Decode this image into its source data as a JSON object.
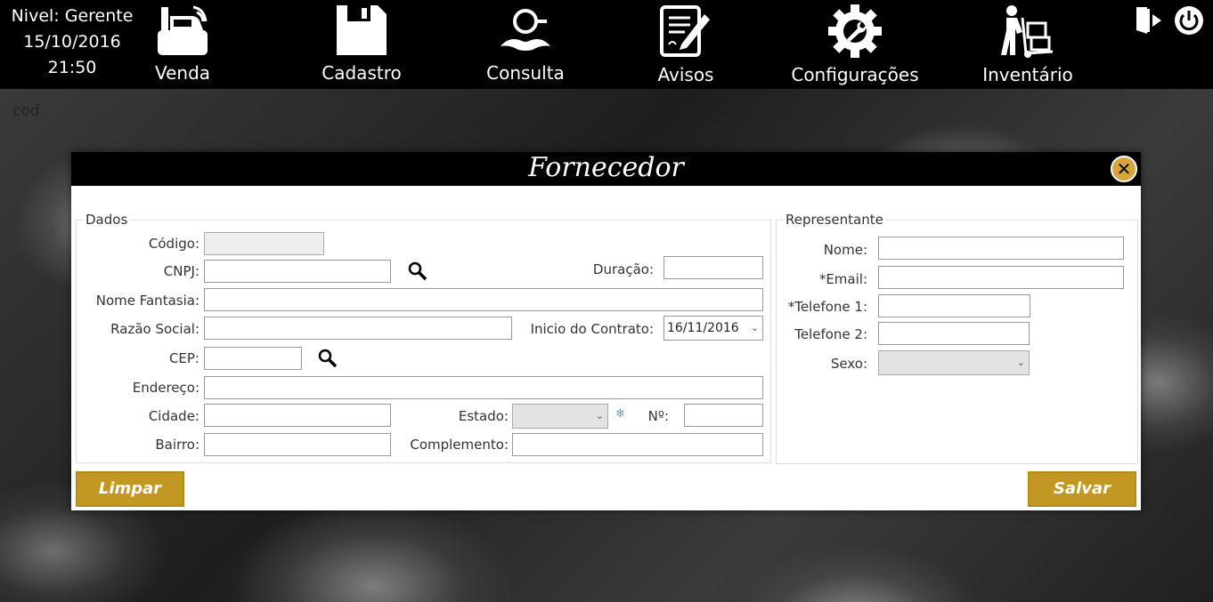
{
  "status": {
    "level": "Nivel: Gerente",
    "date": "15/10/2016",
    "time": "21:50"
  },
  "nav": {
    "venda": "Venda",
    "cadastro": "Cadastro",
    "consulta": "Consulta",
    "avisos": "Avisos",
    "configuracoes": "Configurações",
    "inventario": "Inventário"
  },
  "page": {
    "cod": "cod"
  },
  "dialog": {
    "title": "Fornecedor",
    "close_symbol": "✕",
    "dados": {
      "legend": "Dados",
      "codigo_label": "Código:",
      "cnpj_label": "CNPJ:",
      "duracao_label": "Duração:",
      "nome_fantasia_label": "Nome Fantasia:",
      "razao_social_label": "Razão Social:",
      "inicio_contrato_label": "Inicio do Contrato:",
      "inicio_contrato_value": "16/11/2016",
      "cep_label": "CEP:",
      "endereco_label": "Endereço:",
      "cidade_label": "Cidade:",
      "estado_label": "Estado:",
      "numero_label": "Nº:",
      "bairro_label": "Bairro:",
      "complemento_label": "Complemento:",
      "required_star": "❄"
    },
    "representante": {
      "legend": "Representante",
      "nome_label": "Nome:",
      "email_label": "*Email:",
      "telefone1_label": "*Telefone 1:",
      "telefone2_label": "Telefone 2:",
      "sexo_label": "Sexo:"
    },
    "buttons": {
      "limpar": "Limpar",
      "salvar": "Salvar"
    }
  },
  "colors": {
    "accent": "#c29722",
    "close": "#d8a53a",
    "topbar": "#000000"
  }
}
